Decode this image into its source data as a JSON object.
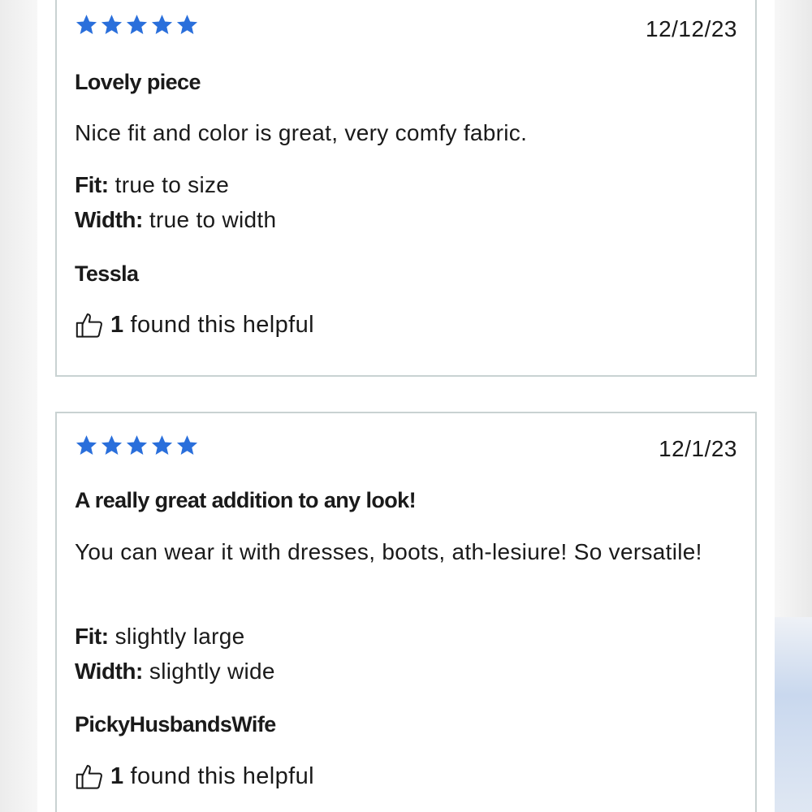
{
  "colors": {
    "star": "#2a6fdb",
    "card_border": "#c9d2d2",
    "text": "#1a1a1a"
  },
  "reviews": [
    {
      "rating": 5,
      "date": "12/12/23",
      "title": "Lovely piece",
      "body": "Nice fit and color is great, very comfy fabric.",
      "fit_label": "Fit:",
      "fit_value": "true to size",
      "width_label": "Width:",
      "width_value": "true to width",
      "author": "Tessla",
      "helpful_count": "1",
      "helpful_text": "found this helpful",
      "helpful_icon": "thumbs-up-icon"
    },
    {
      "rating": 5,
      "date": "12/1/23",
      "title": "A really great addition to any look!",
      "body": "You can wear it with dresses, boots, ath-lesiure! So versatile!",
      "fit_label": "Fit:",
      "fit_value": "slightly large",
      "width_label": "Width:",
      "width_value": "slightly wide",
      "author": "PickyHusbandsWife",
      "helpful_count": "1",
      "helpful_text": "found this helpful",
      "helpful_icon": "thumbs-up-icon"
    }
  ]
}
